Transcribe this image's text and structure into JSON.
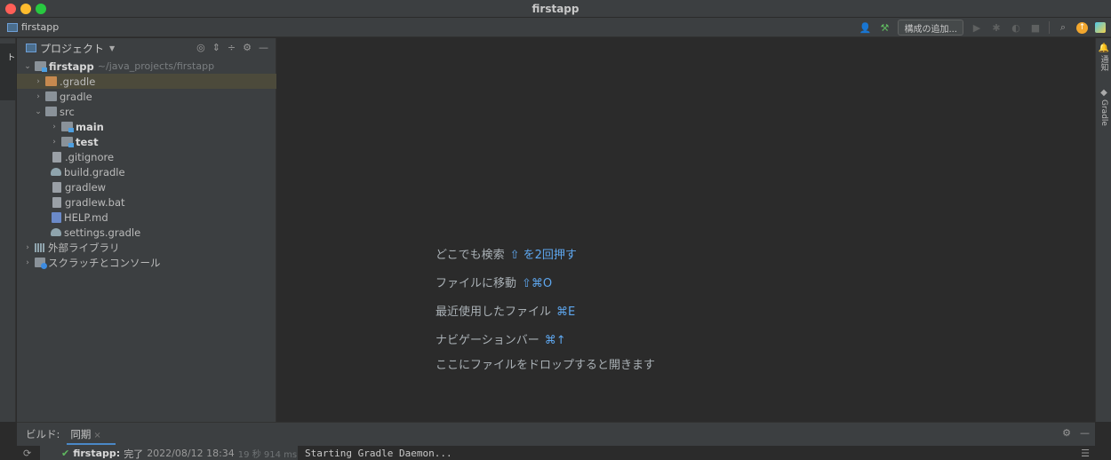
{
  "window": {
    "title": "firstapp"
  },
  "navbar": {
    "project_name": "firstapp",
    "config_button": "構成の追加..."
  },
  "left_strip": {
    "project_tab": "プロジェクト"
  },
  "right_strip": {
    "notifications": "通知",
    "gradle": "Gradle"
  },
  "project_panel": {
    "title": "プロジェクト",
    "tree": [
      {
        "label": "firstapp",
        "path": "~/java_projects/firstapp"
      },
      {
        "label": ".gradle"
      },
      {
        "label": "gradle"
      },
      {
        "label": "src"
      },
      {
        "label": "main"
      },
      {
        "label": "test"
      },
      {
        "label": ".gitignore"
      },
      {
        "label": "build.gradle"
      },
      {
        "label": "gradlew"
      },
      {
        "label": "gradlew.bat"
      },
      {
        "label": "HELP.md"
      },
      {
        "label": "settings.gradle"
      },
      {
        "label": "外部ライブラリ"
      },
      {
        "label": "スクラッチとコンソール"
      }
    ]
  },
  "editor": {
    "hints": [
      {
        "text": "どこでも検索",
        "key": "⇧ を2回押す"
      },
      {
        "text": "ファイルに移動",
        "key": "⇧⌘O"
      },
      {
        "text": "最近使用したファイル",
        "key": "⌘E"
      },
      {
        "text": "ナビゲーションバー",
        "key": "⌘↑"
      },
      {
        "text": "ここにファイルをドロップすると開きます",
        "key": ""
      }
    ]
  },
  "build": {
    "label": "ビルド:",
    "tab": "同期",
    "result_name": "firstapp:",
    "result_status": "完了",
    "result_time": "2022/08/12 18:34",
    "result_duration": "19 秒 914 ms",
    "console_line": "Starting Gradle Daemon..."
  }
}
